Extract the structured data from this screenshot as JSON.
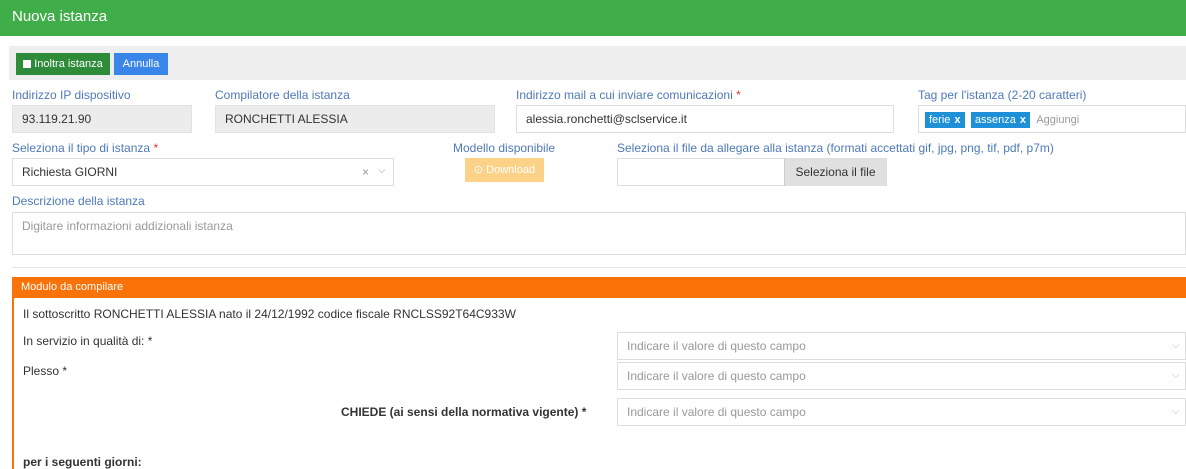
{
  "window": {
    "title": "Nuova istanza"
  },
  "toolbar": {
    "submit_label": "Inoltra istanza",
    "cancel_label": "Annulla"
  },
  "fields": {
    "ip": {
      "label": "Indirizzo IP dispositivo",
      "value": "93.119.21.90"
    },
    "compiler": {
      "label": "Compilatore della istanza",
      "value": "RONCHETTI ALESSIA"
    },
    "email": {
      "label": "Indirizzo mail a cui inviare comunicazioni",
      "required_mark": "*",
      "value": "alessia.ronchetti@sclservice.it"
    },
    "tags": {
      "label": "Tag per l'istanza (2-20 caratteri)",
      "items": [
        "ferie",
        "assenza"
      ],
      "remove_glyph": "x",
      "placeholder": "Aggiungi"
    },
    "type": {
      "label": "Seleziona il tipo di istanza",
      "required_mark": "*",
      "value": "Richiesta GIORNI"
    },
    "model": {
      "label": "Modello disponibile",
      "download_label": "Download"
    },
    "file": {
      "label": "Seleziona il file da allegare alla istanza (formati accettati gif, jpg, png, tif, pdf, p7m)",
      "button_label": "Seleziona il file"
    },
    "description": {
      "label": "Descrizione della istanza",
      "placeholder": "Digitare informazioni addizionali istanza"
    }
  },
  "module": {
    "header": "Modulo da compilare",
    "intro": "Il sottoscritto RONCHETTI ALESSIA nato il 24/12/1992 codice fiscale RNCLSS92T64C933W",
    "rows": [
      {
        "label": "In servizio in qualità di: *",
        "placeholder": "Indicare il valore di questo campo"
      },
      {
        "label": "Plesso *",
        "placeholder": "Indicare il valore di questo campo"
      },
      {
        "label": "CHIEDE (ai sensi della normativa vigente) *",
        "placeholder": "Indicare il valore di questo campo"
      }
    ],
    "footer": "per i seguenti giorni:"
  },
  "icons": {
    "submit": "save-icon",
    "download": "cloud-download-icon",
    "clear": "clear-icon",
    "dropdown": "chevron-down-icon"
  }
}
